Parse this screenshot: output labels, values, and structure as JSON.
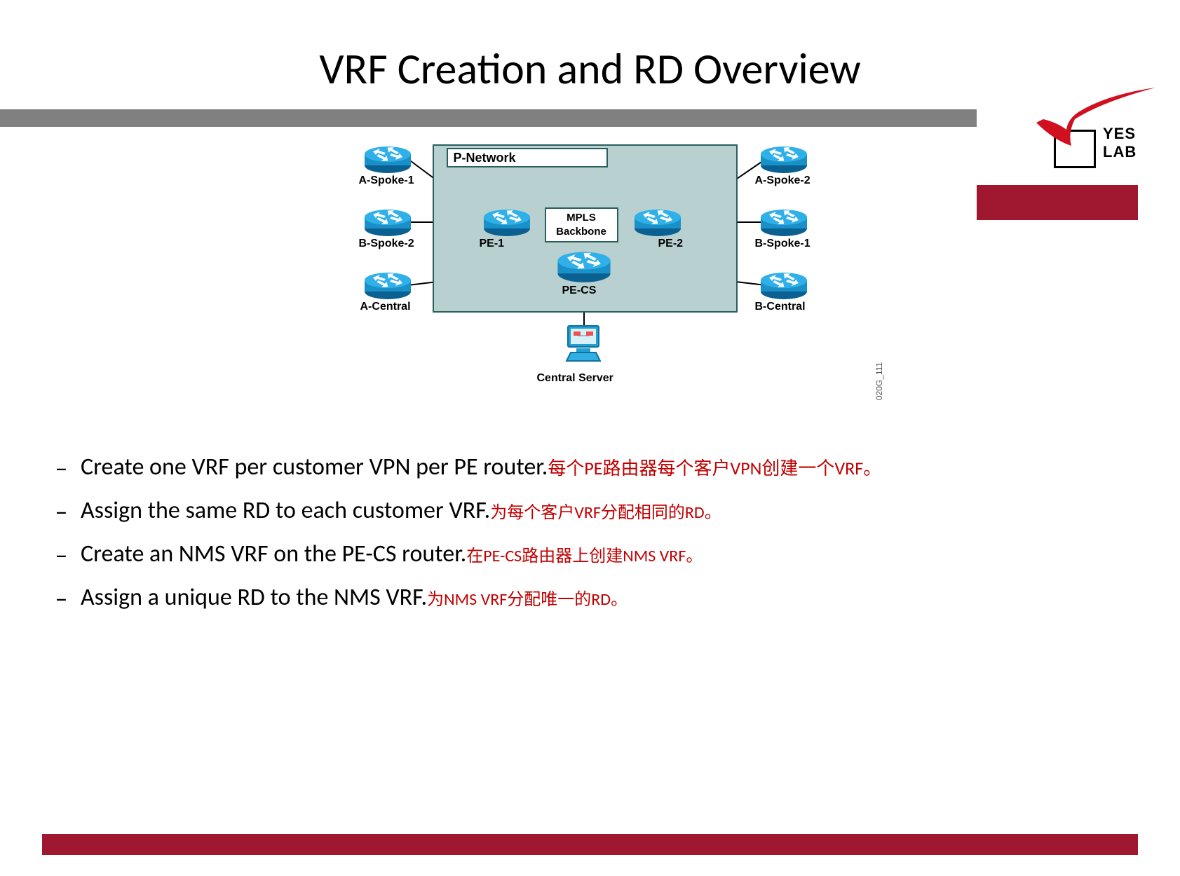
{
  "title": "VRF Creation and RD Overview",
  "logo": {
    "text": "YES LAB"
  },
  "diagram": {
    "pnetwork": "P-Network",
    "mpls_line1": "MPLS",
    "mpls_line2": "Backbone",
    "routers": {
      "a_spoke_1": "A-Spoke-1",
      "b_spoke_2": "B-Spoke-2",
      "a_central": "A-Central",
      "a_spoke_2": "A-Spoke-2",
      "b_spoke_1": "B-Spoke-1",
      "b_central": "B-Central",
      "pe_1": "PE-1",
      "pe_2": "PE-2",
      "pe_cs": "PE-CS"
    },
    "central_server": "Central Server",
    "id": "020G_111"
  },
  "bullets": [
    {
      "en": "Create one VRF per customer VPN per PE  router.",
      "zh": "每个PE路由器每个客户VPN创建一个VRF。"
    },
    {
      "en": "Assign the same RD to each customer VRF.",
      "zh": "为每个客户VRF分配相同的RD。"
    },
    {
      "en": "Create an NMS VRF on the PE-CS router.",
      "zh": "在PE-CS路由器上创建NMS  VRF。"
    },
    {
      "en": "Assign a unique RD to the NMS VRF.",
      "zh": "为NMS  VRF分配唯一的RD。"
    }
  ]
}
